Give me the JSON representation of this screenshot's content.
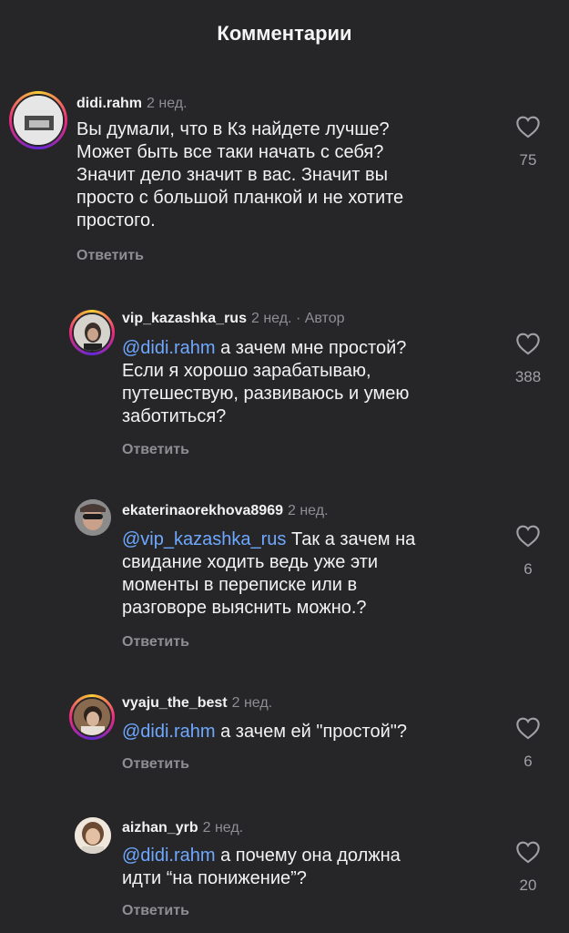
{
  "header": {
    "title": "Комментарии"
  },
  "comments": [
    {
      "username": "didi.rahm",
      "time": "2 нед.",
      "author_badge": "",
      "mention": "",
      "text": "Вы думали, что в Кз найдете лучше?\nМожет быть все таки начать с себя?\nЗначит дело значит в вас. Значит вы\nпросто с большой планкой и не хотите\nпростого.",
      "reply_label": "Ответить",
      "likes": "75"
    },
    {
      "username": "vip_kazashka_rus",
      "time": "2 нед.",
      "author_badge": "· Автор",
      "mention": "@didi.rahm",
      "text": " а зачем мне простой?\nЕсли я хорошо зарабатываю,\nпутешествую, развиваюсь и умею\nзаботиться?",
      "reply_label": "Ответить",
      "likes": "388"
    },
    {
      "username": "ekaterinaorekhova8969",
      "time": "2 нед.",
      "author_badge": "",
      "mention": "@vip_kazashka_rus",
      "text": " Так а зачем на\nсвидание ходить ведь уже эти\nмоменты  в переписке или  в\nразговоре выяснить можно.?",
      "reply_label": "Ответить",
      "likes": "6"
    },
    {
      "username": "vyaju_the_best",
      "time": "2 нед.",
      "author_badge": "",
      "mention": "@didi.rahm",
      "text": " а зачем ей \"простой\"?",
      "reply_label": "Ответить",
      "likes": "6"
    },
    {
      "username": "aizhan_yrb",
      "time": "2 нед.",
      "author_badge": "",
      "mention": "@didi.rahm",
      "text": " а почему она должна\nидти “на понижение”?",
      "reply_label": "Ответить",
      "likes": "20"
    }
  ],
  "colors": {
    "background": "#262629",
    "mention": "#6ea8ff",
    "muted": "#8e8e93"
  },
  "icons": {
    "like": "heart-outline-icon"
  }
}
